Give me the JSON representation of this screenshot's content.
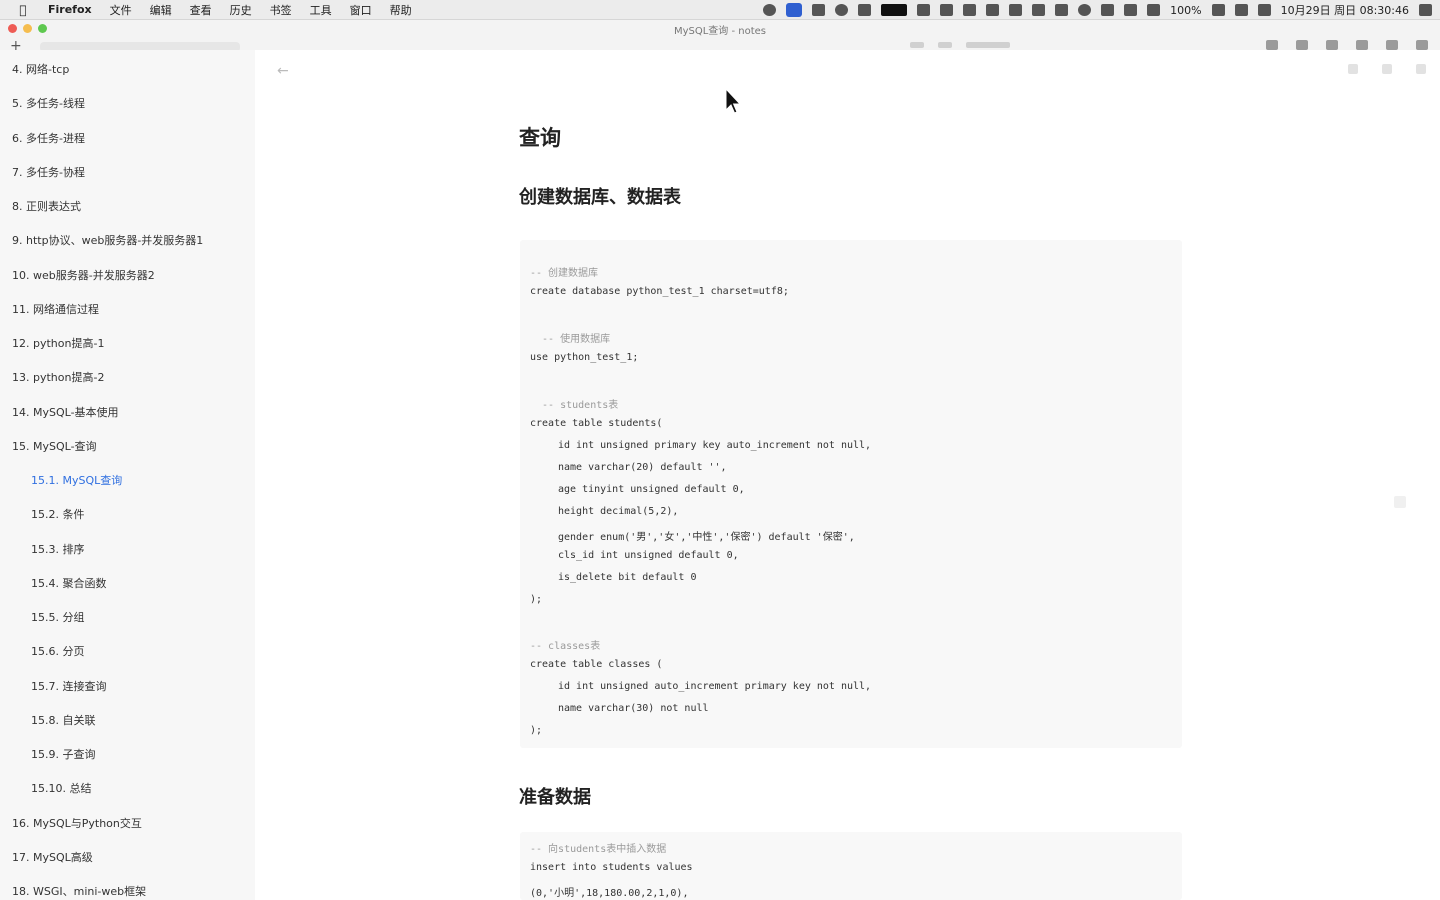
{
  "menubar": {
    "apple_icon": "apple-icon",
    "app_name": "Firefox",
    "menus": [
      "文件",
      "编辑",
      "查看",
      "历史",
      "书签",
      "工具",
      "窗口",
      "帮助"
    ],
    "battery": "100%",
    "datetime": "10月29日 周日 08:30:46"
  },
  "window": {
    "title": "MySQL查询 - notes"
  },
  "sidebar": {
    "items": [
      {
        "label": "4. 网络-tcp",
        "level": 1
      },
      {
        "label": "5. 多任务-线程",
        "level": 1
      },
      {
        "label": "6. 多任务-进程",
        "level": 1
      },
      {
        "label": "7. 多任务-协程",
        "level": 1
      },
      {
        "label": "8. 正则表达式",
        "level": 1
      },
      {
        "label": "9. http协议、web服务器-并发服务器1",
        "level": 1
      },
      {
        "label": "10. web服务器-并发服务器2",
        "level": 1
      },
      {
        "label": "11. 网络通信过程",
        "level": 1
      },
      {
        "label": "12. python提高-1",
        "level": 1
      },
      {
        "label": "13. python提高-2",
        "level": 1
      },
      {
        "label": "14. MySQL-基本使用",
        "level": 1
      },
      {
        "label": "15. MySQL-查询",
        "level": 1
      },
      {
        "label": "15.1. MySQL查询",
        "level": 2,
        "active": true
      },
      {
        "label": "15.2. 条件",
        "level": 2
      },
      {
        "label": "15.3. 排序",
        "level": 2
      },
      {
        "label": "15.4. 聚合函数",
        "level": 2
      },
      {
        "label": "15.5. 分组",
        "level": 2
      },
      {
        "label": "15.6. 分页",
        "level": 2
      },
      {
        "label": "15.7. 连接查询",
        "level": 2
      },
      {
        "label": "15.8. 自关联",
        "level": 2
      },
      {
        "label": "15.9. 子查询",
        "level": 2
      },
      {
        "label": "15.10. 总结",
        "level": 2
      },
      {
        "label": "16. MySQL与Python交互",
        "level": 1
      },
      {
        "label": "17. MySQL高级",
        "level": 1
      },
      {
        "label": "18. WSGI、mini-web框架",
        "level": 1
      }
    ]
  },
  "main": {
    "title": "查询",
    "section1": "创建数据库、数据表",
    "code1": [
      {
        "text": "-- 创建数据库",
        "cls": "comment"
      },
      {
        "text": "create database python_test_1 charset=utf8;",
        "cls": ""
      },
      {
        "text": "  -- 使用数据库",
        "cls": "comment"
      },
      {
        "text": "use python_test_1;",
        "cls": ""
      },
      {
        "text": "  -- students表",
        "cls": "comment"
      },
      {
        "text": "create table students(",
        "cls": ""
      },
      {
        "text": "id int unsigned primary key auto_increment not null,",
        "cls": "indent1"
      },
      {
        "text": "name varchar(20) default '',",
        "cls": "indent1"
      },
      {
        "text": "age tinyint unsigned default 0,",
        "cls": "indent1"
      },
      {
        "text": "height decimal(5,2),",
        "cls": "indent1"
      },
      {
        "text": "gender enum('男','女','中性','保密') default '保密',",
        "cls": "indent1"
      },
      {
        "text": "cls_id int unsigned default 0,",
        "cls": "indent1"
      },
      {
        "text": "is_delete bit default 0",
        "cls": "indent1"
      },
      {
        "text": ");",
        "cls": ""
      },
      {
        "text": "-- classes表",
        "cls": "comment"
      },
      {
        "text": "create table classes (",
        "cls": ""
      },
      {
        "text": "id int unsigned auto_increment primary key not null,",
        "cls": "indent1"
      },
      {
        "text": "name varchar(30) not null",
        "cls": "indent1"
      },
      {
        "text": ");",
        "cls": ""
      }
    ],
    "section2": "准备数据",
    "code2": [
      {
        "text": "-- 向students表中插入数据",
        "cls": "comment"
      },
      {
        "text": "insert into students values",
        "cls": ""
      },
      {
        "text": "(0,'小明',18,180.00,2,1,0),",
        "cls": ""
      }
    ]
  }
}
